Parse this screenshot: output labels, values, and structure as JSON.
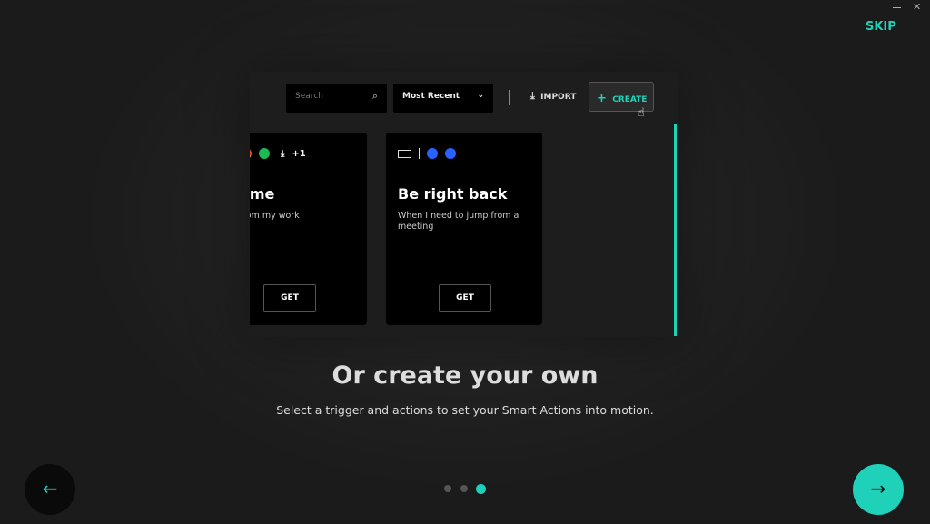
{
  "window": {
    "skip_label": "SKIP",
    "minimize_icon": "minimize-icon",
    "close_icon": "close-icon"
  },
  "preview": {
    "search_placeholder": "Search",
    "sort_value": "Most Recent",
    "import_label": "IMPORT",
    "create_label": "CREATE",
    "cards": [
      {
        "title": "us Time",
        "description": "pause from my work",
        "extra_count": "+1",
        "button": "GET"
      },
      {
        "title": "Be right back",
        "description": "When I need to jump from a meeting",
        "button": "GET"
      }
    ]
  },
  "heading": "Or create your own",
  "subheading": "Select a trigger and actions to set your Smart Actions into motion.",
  "pagination": {
    "total": 3,
    "current": 3
  },
  "colors": {
    "accent": "#1fd1b8",
    "background": "#1e1e1e"
  }
}
